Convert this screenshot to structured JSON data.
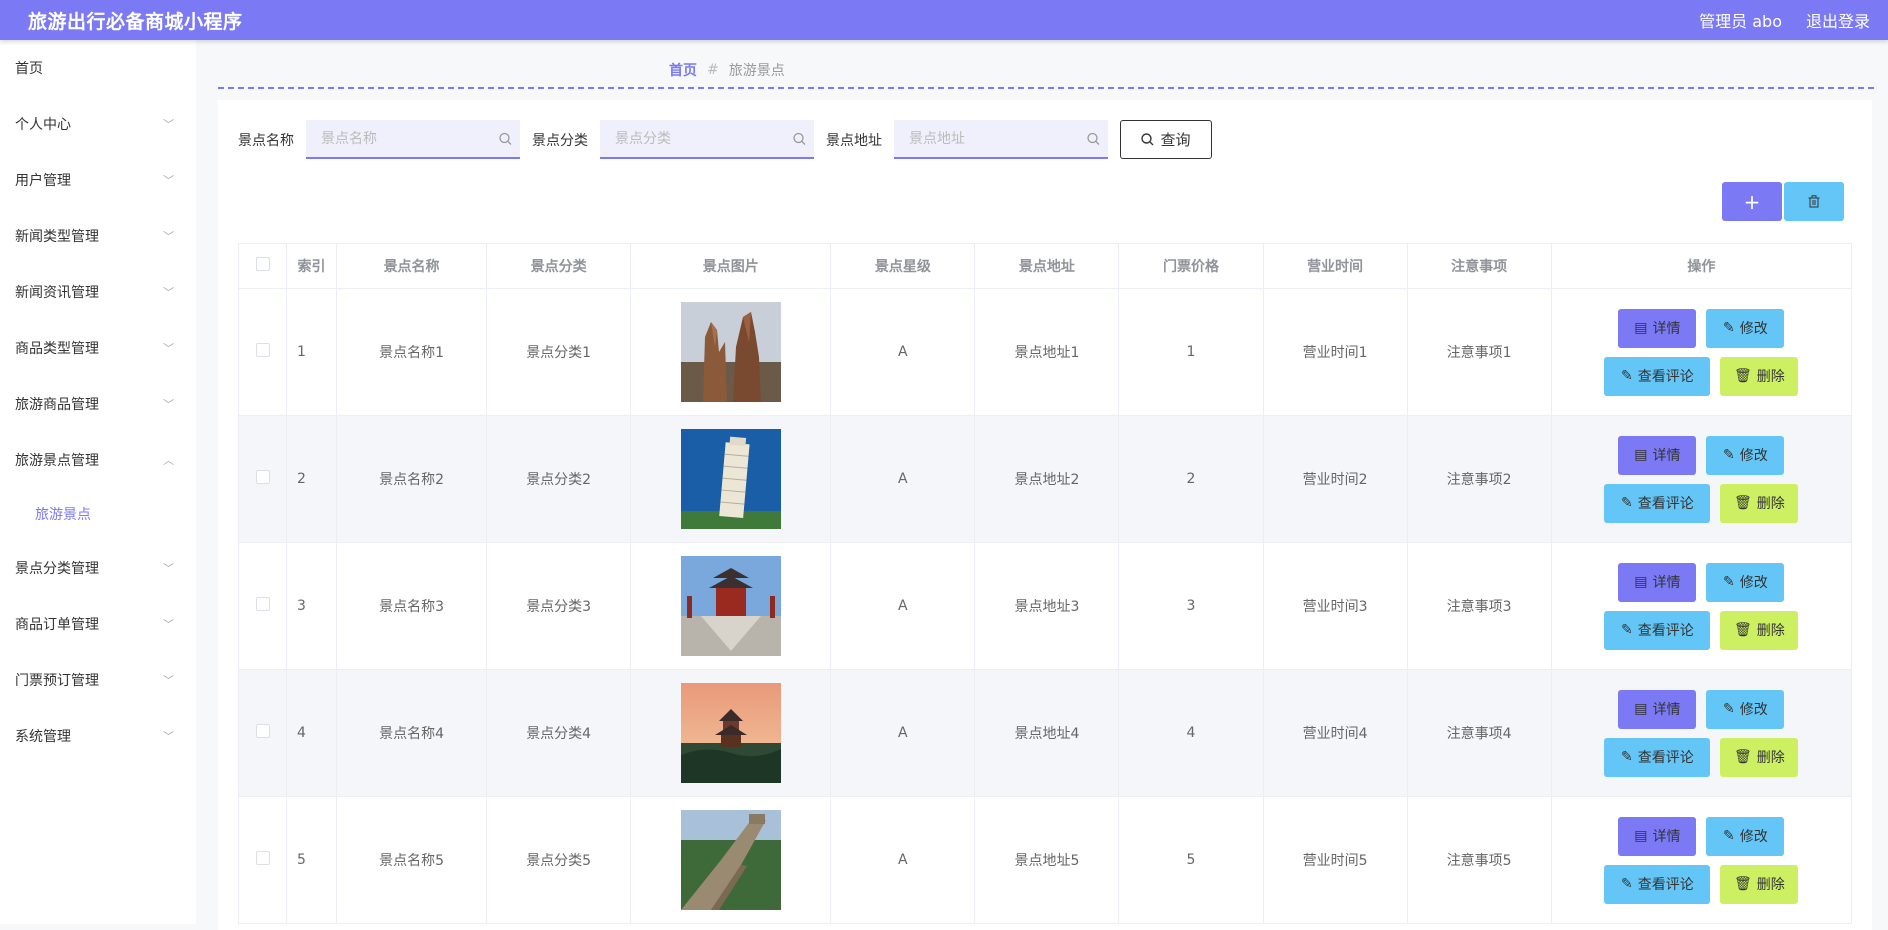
{
  "app": {
    "title": "旅游出行必备商城小程序"
  },
  "header": {
    "admin_label": "管理员 abo",
    "logout_label": "退出登录"
  },
  "sidebar": {
    "items": [
      {
        "label": "首页",
        "expandable": false
      },
      {
        "label": "个人中心",
        "expandable": true
      },
      {
        "label": "用户管理",
        "expandable": true
      },
      {
        "label": "新闻类型管理",
        "expandable": true
      },
      {
        "label": "新闻资讯管理",
        "expandable": true
      },
      {
        "label": "商品类型管理",
        "expandable": true
      },
      {
        "label": "旅游商品管理",
        "expandable": true
      },
      {
        "label": "旅游景点管理",
        "expandable": true,
        "expanded": true
      },
      {
        "label": "景点分类管理",
        "expandable": true
      },
      {
        "label": "商品订单管理",
        "expandable": true
      },
      {
        "label": "门票预订管理",
        "expandable": true
      },
      {
        "label": "系统管理",
        "expandable": true
      }
    ],
    "active_sub": "旅游景点"
  },
  "breadcrumb": {
    "home": "首页",
    "separator": "#",
    "current": "旅游景点"
  },
  "search": {
    "fields": [
      {
        "label": "景点名称",
        "placeholder": "景点名称",
        "value": ""
      },
      {
        "label": "景点分类",
        "placeholder": "景点分类",
        "value": ""
      },
      {
        "label": "景点地址",
        "placeholder": "景点地址",
        "value": ""
      }
    ],
    "query_label": "查询"
  },
  "toolbar": {
    "add_icon": "plus-icon",
    "delete_icon": "trash-icon"
  },
  "table": {
    "headers": [
      "索引",
      "景点名称",
      "景点分类",
      "景点图片",
      "景点星级",
      "景点地址",
      "门票价格",
      "营业时间",
      "注意事项",
      "操作"
    ],
    "rows": [
      {
        "index": "1",
        "name": "景点名称1",
        "category": "景点分类1",
        "image": "rock-peaks",
        "star": "A",
        "address": "景点地址1",
        "price": "1",
        "hours": "营业时间1",
        "notes": "注意事项1"
      },
      {
        "index": "2",
        "name": "景点名称2",
        "category": "景点分类2",
        "image": "leaning-tower",
        "star": "A",
        "address": "景点地址2",
        "price": "2",
        "hours": "营业时间2",
        "notes": "注意事项2"
      },
      {
        "index": "3",
        "name": "景点名称3",
        "category": "景点分类3",
        "image": "pagoda-plaza",
        "star": "A",
        "address": "景点地址3",
        "price": "3",
        "hours": "营业时间3",
        "notes": "注意事项3"
      },
      {
        "index": "4",
        "name": "景点名称4",
        "category": "景点分类4",
        "image": "sunset-pavilion",
        "star": "A",
        "address": "景点地址4",
        "price": "4",
        "hours": "营业时间4",
        "notes": "注意事项4"
      },
      {
        "index": "5",
        "name": "景点名称5",
        "category": "景点分类5",
        "image": "great-wall",
        "star": "A",
        "address": "景点地址5",
        "price": "5",
        "hours": "营业时间5",
        "notes": "注意事项5"
      }
    ],
    "actions": {
      "detail": "详情",
      "edit": "修改",
      "comments": "查看评论",
      "delete": "删除"
    }
  },
  "colors": {
    "primary": "#7b79f4",
    "info": "#63c6f7",
    "warn": "#cdf063"
  }
}
